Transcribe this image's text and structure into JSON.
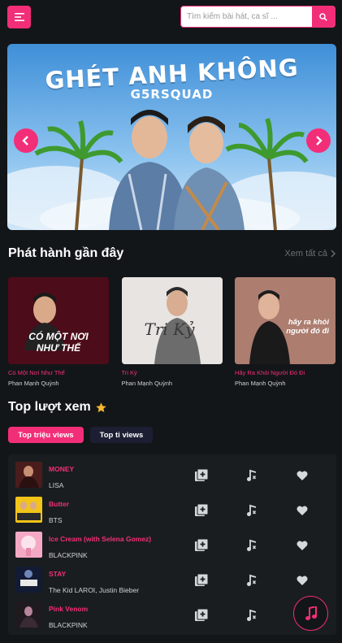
{
  "search": {
    "placeholder": "Tìm kiếm bài hát, ca sĩ ..."
  },
  "banner": {
    "title": "GHÉT ANH KHÔNG",
    "subtitle": "G5RSQUAD"
  },
  "recent": {
    "title": "Phát hành gần đây",
    "see_all": "Xem tất cả",
    "albums": [
      {
        "title": "Có Một Nơi Như Thế",
        "artist": "Phan Mạnh Quỳnh",
        "cover_text": "CÓ MỘT NƠI NHƯ THẾ"
      },
      {
        "title": "Tri Kỷ",
        "artist": "Phan Mạnh Quỳnh",
        "cover_text": "Tri Kỷ"
      },
      {
        "title": "Hãy Ra Khỏi Người Đó Đi",
        "artist": "Phan Mạnh Quỳnh",
        "cover_text": "hãy ra khỏi người đó đi"
      }
    ]
  },
  "top": {
    "title": "Top lượt xem",
    "tabs": [
      "Top triệu views",
      "Top tỉ views"
    ],
    "songs": [
      {
        "name": "MONEY",
        "artist": "LISA"
      },
      {
        "name": "Butter",
        "artist": "BTS"
      },
      {
        "name": "Ice Cream (with Selena Gomez)",
        "artist": "BLACKPINK"
      },
      {
        "name": "STAY",
        "artist": "The Kid LAROI, Justin Bieber"
      },
      {
        "name": "Pink Venom",
        "artist": "BLACKPINK"
      }
    ]
  },
  "colors": {
    "accent": "#f22e78",
    "background": "#131619",
    "panel": "#1a1d20"
  }
}
